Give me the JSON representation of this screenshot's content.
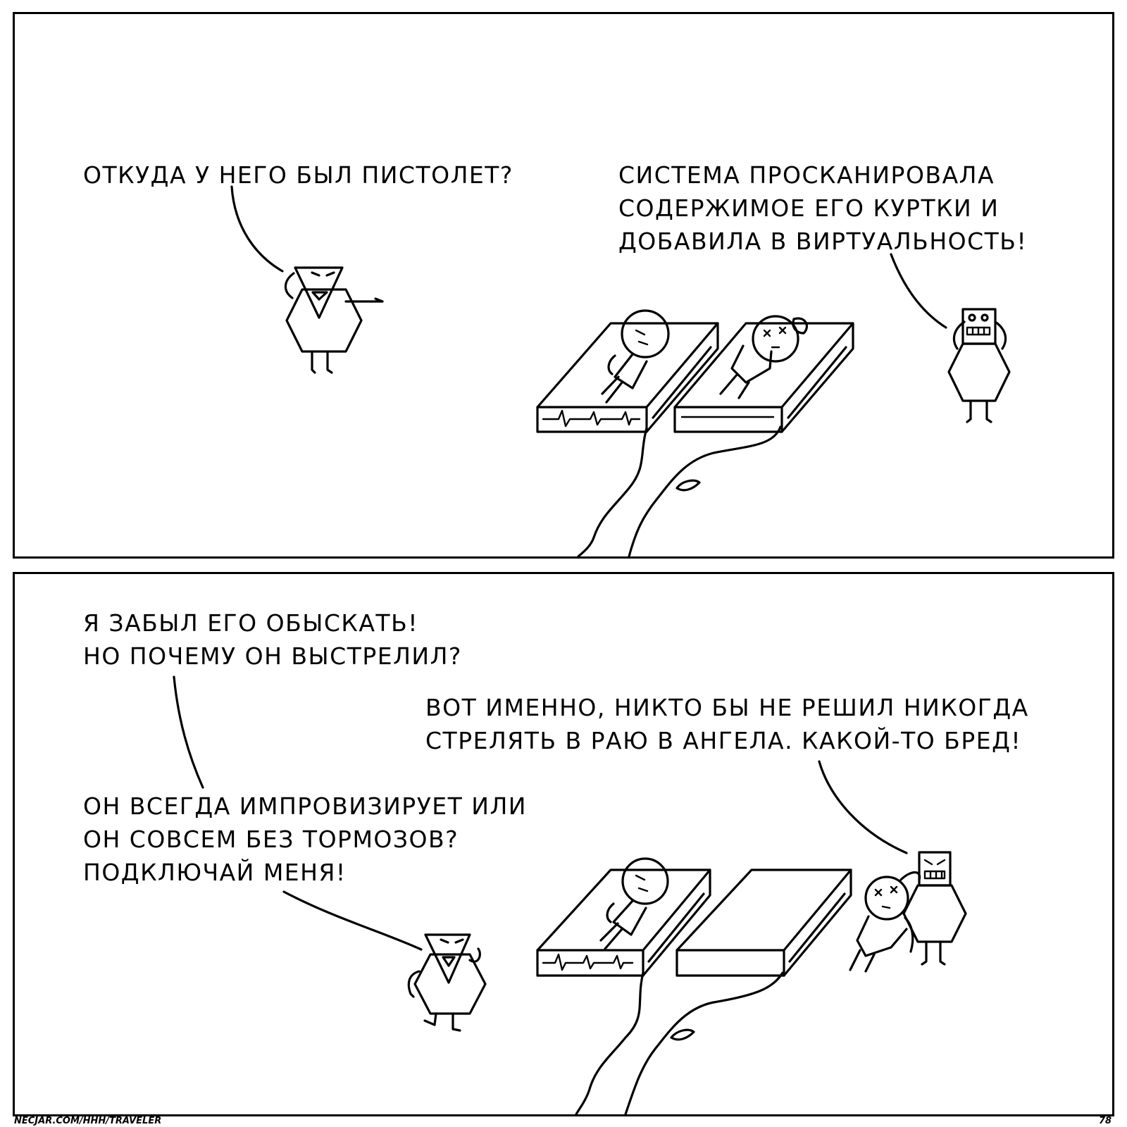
{
  "panels": [
    {
      "speech": [
        "ОТКУДА У НЕГО БЫЛ ПИСТОЛЕТ?",
        "СИСТЕМА ПРОСКАНИРОВАЛА\nСОДЕРЖИМОЕ ЕГО КУРТКИ И\nДОБАВИЛА В ВИРТУАЛЬНОСТЬ!"
      ]
    },
    {
      "speech": [
        "Я ЗАБЫЛ ЕГО ОБЫСКАТЬ!\nНО ПОЧЕМУ ОН ВЫСТРЕЛИЛ?",
        "ВОТ ИМЕННО, НИКТО БЫ НЕ РЕШИЛ НИКОГДА\nСТРЕЛЯТЬ В РАЮ В АНГЕЛА. КАКОЙ-ТО БРЕД!",
        "ОН ВСЕГДА ИМПРОВИЗИРУЕТ ИЛИ\nОН СОВСЕМ БЕЗ ТОРМОЗОВ?\nПОДКЛЮЧАЙ МЕНЯ!"
      ]
    }
  ],
  "footer": {
    "url": "NECJAR.COM/HHH/TRAVELER",
    "page_number": "78"
  },
  "colors": {
    "ink": "#000000",
    "paper": "#ffffff"
  }
}
